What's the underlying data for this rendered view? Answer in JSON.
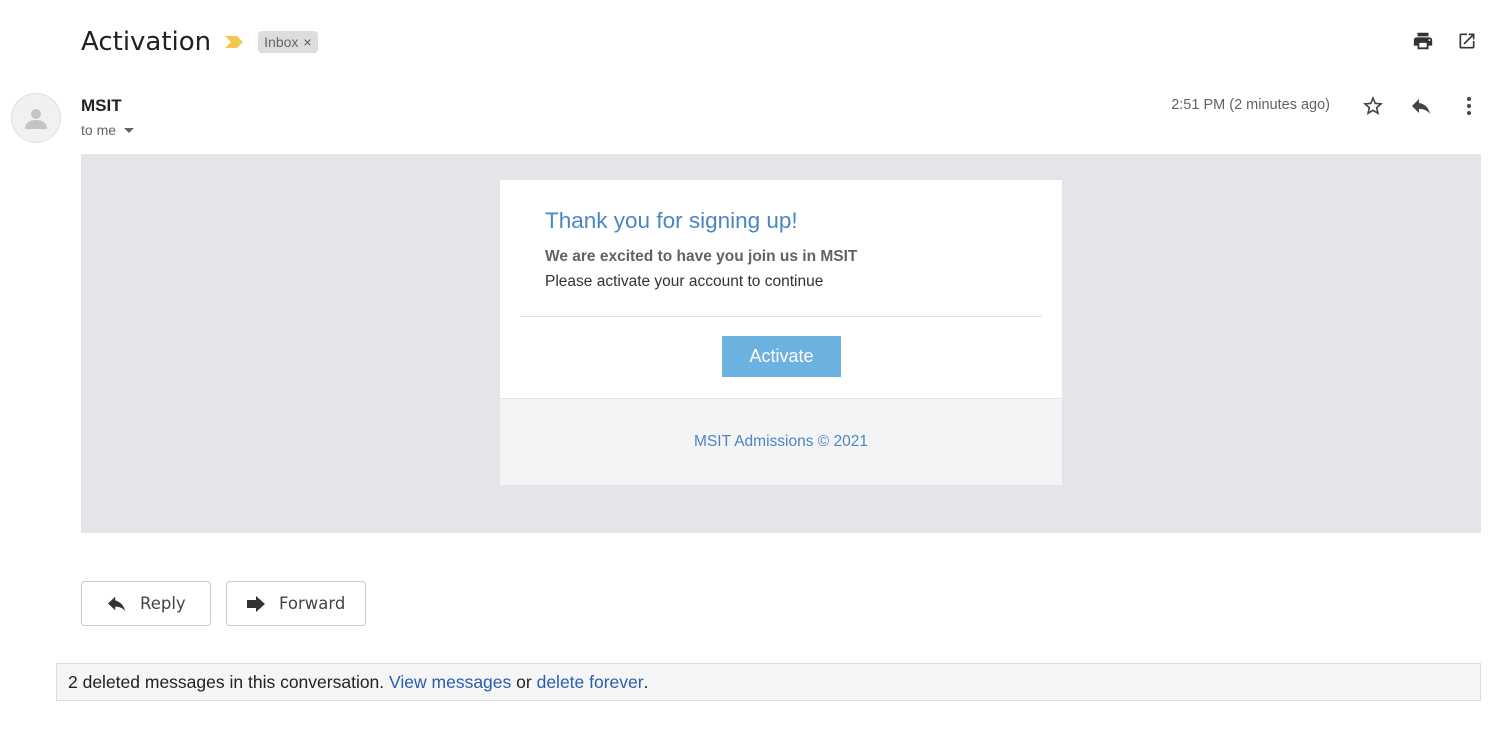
{
  "thread": {
    "subject": "Activation",
    "label": "Inbox",
    "label_remove": "×"
  },
  "toolbar": {
    "icons": [
      "print-icon",
      "open-in-new-window-icon"
    ]
  },
  "message": {
    "sender": "MSIT",
    "recipient": "to me",
    "timestamp": "2:51 PM (2 minutes ago)",
    "icons": [
      "star-icon",
      "reply-icon",
      "more-vert-icon"
    ]
  },
  "email_body": {
    "title": "Thank you for signing up!",
    "bold_line": "We are excited to have you join us in MSIT",
    "text_line": "Please activate your account to continue",
    "button_label": "Activate",
    "footer": "MSIT Admissions © 2021"
  },
  "actions": {
    "reply_label": "Reply",
    "forward_label": "Forward"
  },
  "deleted_notice": {
    "prefix": "2 deleted messages in this conversation.",
    "view_link": "View messages",
    "middle": "or",
    "delete_link": "delete forever",
    "suffix": "."
  },
  "colors": {
    "accent_blue": "#4a86c5",
    "button_blue": "#6cb2e0",
    "importance_yellow": "#f2c94c",
    "body_frame_bg": "#e4e5e9"
  }
}
